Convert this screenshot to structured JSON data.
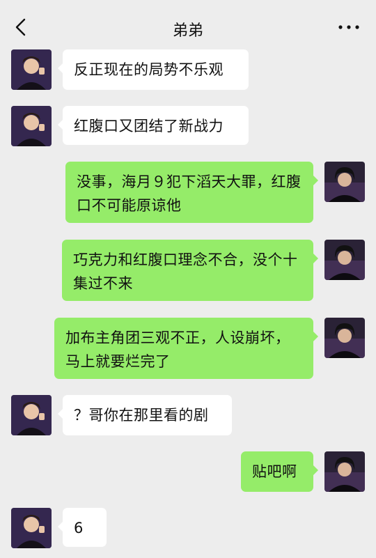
{
  "header": {
    "title": "弟弟",
    "back_icon": "chevron-left-icon",
    "more_icon": "more-dots-icon"
  },
  "messages": [
    {
      "side": "in",
      "text": "反正现在的局势不乐观"
    },
    {
      "side": "in",
      "text": "红腹口又团结了新战力"
    },
    {
      "side": "out",
      "text": "没事，海月９犯下滔天大罪，红腹口不可能原谅他"
    },
    {
      "side": "out",
      "text": "巧克力和红腹口理念不合，没个十集过不来"
    },
    {
      "side": "out",
      "text": "加布主角团三观不正，人设崩坏，马上就要烂完了"
    },
    {
      "side": "in",
      "text": "？哥你在那里看的剧"
    },
    {
      "side": "out",
      "text": "贴吧啊"
    },
    {
      "side": "in",
      "text": "6"
    }
  ],
  "colors": {
    "background": "#ededed",
    "incoming_bubble": "#ffffff",
    "outgoing_bubble": "#95ec69"
  }
}
